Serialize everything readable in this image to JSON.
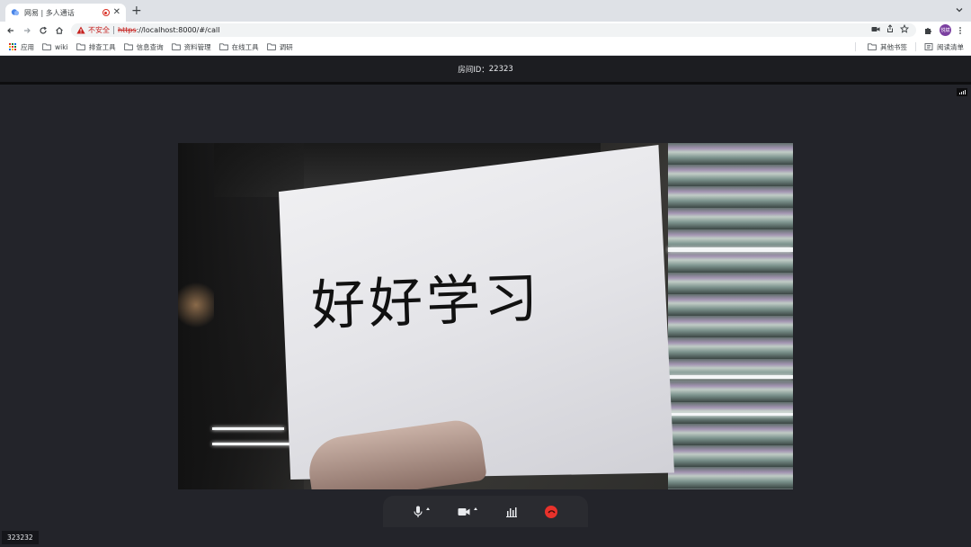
{
  "browser": {
    "tab": {
      "title": "网易 | 多人通话",
      "favicon": "chat-bubble-icon"
    },
    "newtab_label": "+",
    "close_label": "✕",
    "omnibox": {
      "security_label": "不安全",
      "url_scheme": "https",
      "url_rest": "://localhost:8000/#/call"
    },
    "avatar_label": "悦斌",
    "bookmarks": [
      {
        "label": "应用",
        "icon": "apps-grid-icon"
      },
      {
        "label": "wiki",
        "icon": "folder-icon"
      },
      {
        "label": "排查工具",
        "icon": "folder-icon"
      },
      {
        "label": "信息查询",
        "icon": "folder-icon"
      },
      {
        "label": "资料管理",
        "icon": "folder-icon"
      },
      {
        "label": "在线工具",
        "icon": "folder-icon"
      },
      {
        "label": "调研",
        "icon": "folder-icon"
      }
    ],
    "bookmarks_right": [
      {
        "label": "其他书签",
        "icon": "folder-icon"
      },
      {
        "label": "阅读清单",
        "icon": "reading-list-icon"
      }
    ]
  },
  "call": {
    "room_label": "房间ID：",
    "room_id": "22323",
    "video_sign_text": "好好学习",
    "user_id": "323232",
    "controls": [
      "microphone",
      "camera",
      "stats",
      "hang-up"
    ]
  },
  "colors": {
    "page_bg": "#23242a",
    "header_bg": "#1c1d21",
    "hangup_red": "#e8322b",
    "insecure_red": "#c5221f",
    "avatar_purple": "#7b3fa0"
  }
}
